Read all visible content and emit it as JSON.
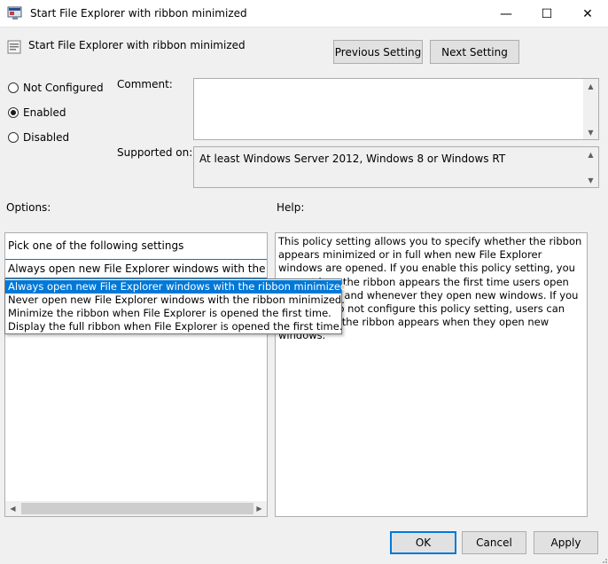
{
  "window": {
    "title": "Start File Explorer with ribbon minimized",
    "minimize_glyph": "—",
    "maximize_glyph": "☐",
    "close_glyph": "✕"
  },
  "header": {
    "policy_name": "Start File Explorer with ribbon minimized",
    "previous_label": "Previous Setting",
    "next_label": "Next Setting"
  },
  "state": {
    "options": [
      {
        "label": "Not Configured",
        "checked": false
      },
      {
        "label": "Enabled",
        "checked": true
      },
      {
        "label": "Disabled",
        "checked": false
      }
    ]
  },
  "comment": {
    "label": "Comment:",
    "value": ""
  },
  "supported": {
    "label": "Supported on:",
    "value": "At least Windows Server 2012, Windows 8 or Windows RT"
  },
  "options": {
    "label": "Options:",
    "prompt": "Pick one of the following settings",
    "selected": "Always open new File Explorer windows with the ribbon minimized.",
    "choices": [
      "Always open new File Explorer windows with the ribbon minimized.",
      "Never open new File Explorer windows with the ribbon minimized.",
      "Minimize the ribbon when File Explorer is opened the first time.",
      "Display the full ribbon when File Explorer is opened the first time."
    ]
  },
  "help": {
    "label": "Help:",
    "text": "This policy setting allows you to specify whether the ribbon appears minimized or in full when new File Explorer windows are opened. If you enable this policy setting, you can set how the ribbon appears the first time users open File Explorer and whenever they open new windows. If you disable or do not configure this policy setting, users can choose how the ribbon appears when they open new windows."
  },
  "footer": {
    "ok_label": "OK",
    "cancel_label": "Cancel",
    "apply_label": "Apply"
  },
  "colors": {
    "accent": "#0078d7",
    "window_bg": "#f0f0f0",
    "button_bg": "#e1e1e1"
  }
}
